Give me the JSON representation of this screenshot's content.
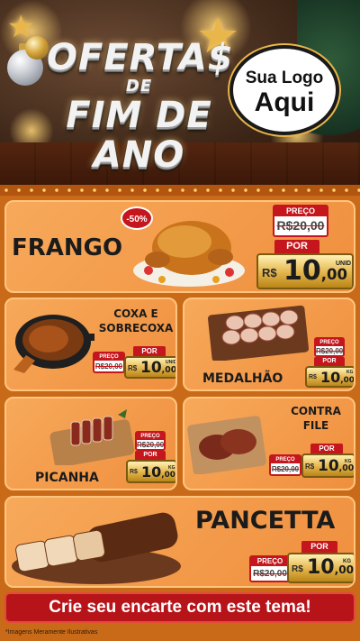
{
  "header": {
    "title_line1": "OFERTA$",
    "title_line2": "DE",
    "title_line3": "FIM DE ANO",
    "logo_line1": "Sua Logo",
    "logo_line2": "Aqui"
  },
  "colors": {
    "background": "#c96a18",
    "card": "#f7a95a",
    "price_red": "#c4161c",
    "gold": "#e3b44a"
  },
  "products": [
    {
      "name": "FRANGO",
      "discount": "-50%",
      "old_label": "PREÇO",
      "old_price": "R$20,00",
      "new_label": "POR",
      "currency": "R$",
      "price": "10",
      "cents": ",00",
      "unit": "UNID"
    },
    {
      "name_line1": "COXA E",
      "name_line2": "SOBRECOXA",
      "old_label": "PREÇO",
      "old_price": "R$20,00",
      "new_label": "POR",
      "currency": "R$",
      "price": "10",
      "cents": ",00",
      "unit": "UNID"
    },
    {
      "name": "MEDALHÃO",
      "old_label": "PREÇO",
      "old_price": "R$20,00",
      "new_label": "POR",
      "currency": "R$",
      "price": "10",
      "cents": ",00",
      "unit": "KG"
    },
    {
      "name": "PICANHA",
      "old_label": "PREÇO",
      "old_price": "R$20,00",
      "new_label": "POR",
      "currency": "R$",
      "price": "10",
      "cents": ",00",
      "unit": "KG"
    },
    {
      "name_line1": "CONTRA",
      "name_line2": "FILE",
      "old_label": "PREÇO",
      "old_price": "R$20,00",
      "new_label": "POR",
      "currency": "R$",
      "price": "10",
      "cents": ",00",
      "unit": "KG"
    },
    {
      "name": "PANCETTA",
      "old_label": "PREÇO",
      "old_price": "R$20,00",
      "new_label": "POR",
      "currency": "R$",
      "price": "10",
      "cents": ",00",
      "unit": "KG"
    }
  ],
  "cta": "Crie seu encarte com este tema!",
  "footnote": "*Imagens Meramente Ilustrativas"
}
